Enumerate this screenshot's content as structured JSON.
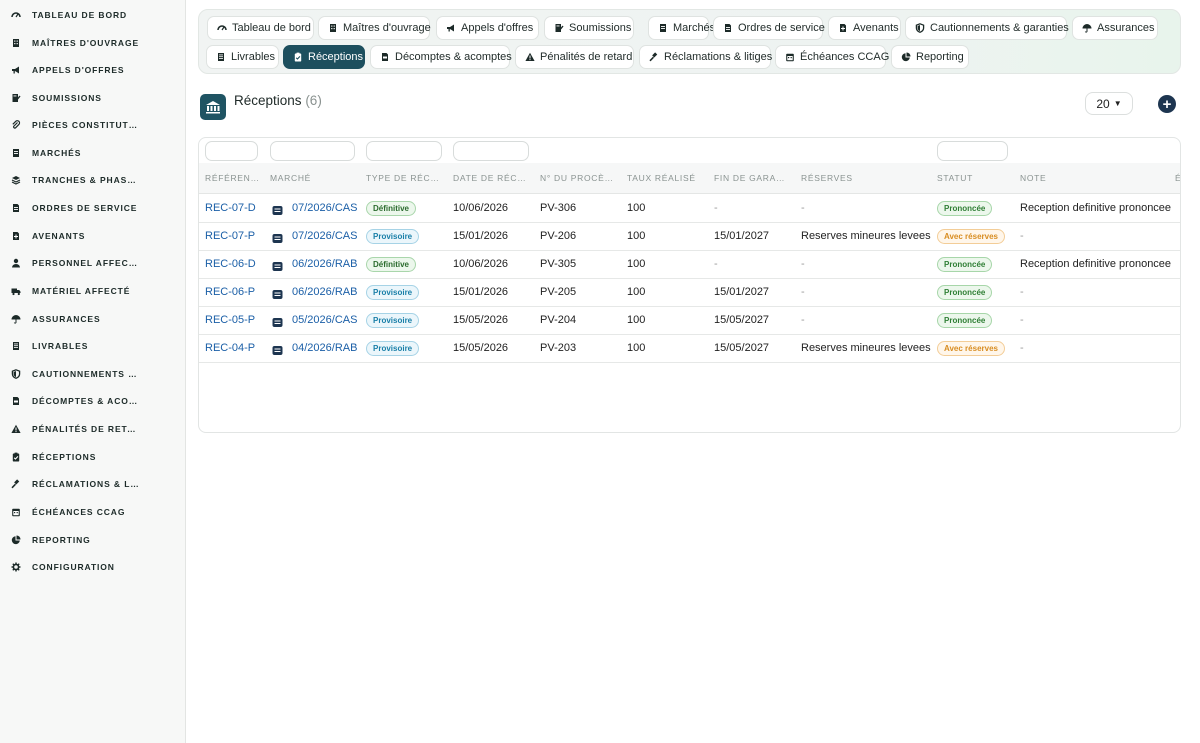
{
  "sidebar": {
    "items": [
      {
        "label": "TABLEAU DE BORD",
        "icon": "dashboard-icon"
      },
      {
        "label": "MAÎTRES D'OUVRAGE",
        "icon": "building-icon"
      },
      {
        "label": "APPELS D'OFFRES",
        "icon": "megaphone-icon"
      },
      {
        "label": "SOUMISSIONS",
        "icon": "file-signature-icon"
      },
      {
        "label": "PIÈCES CONSTITUTIVES",
        "icon": "paperclip-icon"
      },
      {
        "label": "MARCHÉS",
        "icon": "file-contract-icon"
      },
      {
        "label": "TRANCHES & PHASES",
        "icon": "layers-icon"
      },
      {
        "label": "ORDRES DE SERVICE",
        "icon": "file-icon"
      },
      {
        "label": "AVENANTS",
        "icon": "file-plus-icon"
      },
      {
        "label": "PERSONNEL AFFECTÉ",
        "icon": "user-icon"
      },
      {
        "label": "MATÉRIEL AFFECTÉ",
        "icon": "truck-icon"
      },
      {
        "label": "ASSURANCES",
        "icon": "umbrella-icon"
      },
      {
        "label": "LIVRABLES",
        "icon": "file-alt-icon"
      },
      {
        "label": "CAUTIONNEMENTS & GARANTIES",
        "icon": "shield-icon"
      },
      {
        "label": "DÉCOMPTES & ACOMPTES",
        "icon": "file-invoice-icon"
      },
      {
        "label": "PÉNALITÉS DE RETARD",
        "icon": "warning-icon"
      },
      {
        "label": "RÉCEPTIONS",
        "icon": "clipboard-check-icon"
      },
      {
        "label": "RÉCLAMATIONS & LITIGES",
        "icon": "gavel-icon"
      },
      {
        "label": "ÉCHÉANCES CCAG",
        "icon": "calendar-icon"
      },
      {
        "label": "REPORTING",
        "icon": "pie-chart-icon"
      },
      {
        "label": "CONFIGURATION",
        "icon": "gear-icon"
      }
    ]
  },
  "tabs": [
    {
      "label": "Tableau de bord",
      "icon": "dashboard-icon"
    },
    {
      "label": "Maîtres d'ouvrage",
      "icon": "building-icon"
    },
    {
      "label": "Appels d'offres",
      "icon": "megaphone-icon"
    },
    {
      "label": "Soumissions",
      "icon": "file-signature-icon"
    },
    {
      "label": "Marchés",
      "icon": "file-contract-icon"
    },
    {
      "label": "Ordres de service",
      "icon": "file-icon"
    },
    {
      "label": "Avenants",
      "icon": "file-plus-icon"
    },
    {
      "label": "Cautionnements & garanties",
      "icon": "shield-icon"
    },
    {
      "label": "Assurances",
      "icon": "umbrella-icon"
    },
    {
      "label": "Livrables",
      "icon": "file-alt-icon"
    },
    {
      "label": "Réceptions",
      "icon": "clipboard-check-icon",
      "active": true
    },
    {
      "label": "Décomptes & acomptes",
      "icon": "file-invoice-icon"
    },
    {
      "label": "Pénalités de retard",
      "icon": "warning-icon"
    },
    {
      "label": "Réclamations & litiges",
      "icon": "gavel-icon"
    },
    {
      "label": "Échéances CCAG",
      "icon": "calendar-icon"
    },
    {
      "label": "Reporting",
      "icon": "pie-chart-icon"
    }
  ],
  "header": {
    "title": "Réceptions",
    "count": "(6)",
    "page_size": "20",
    "add_label": "+"
  },
  "table": {
    "columns": [
      "RÉFÉRENCE",
      "MARCHÉ",
      "TYPE DE RÉCEPTION",
      "DATE DE RÉCEPTION",
      "N° DU PROCÈS-VERBAL",
      "TAUX RÉALISÉ",
      "FIN DE GARANTIE",
      "RÉSERVES",
      "STATUT",
      "NOTE",
      "É"
    ],
    "rows": [
      {
        "ref": "REC-07-D",
        "marche": "07/2026/CAS",
        "type": "Définitive",
        "date": "10/06/2026",
        "pv": "PV-306",
        "taux": "100",
        "fin": "-",
        "reserves": "-",
        "statut": "Prononcée",
        "note": "Reception definitive prononcee"
      },
      {
        "ref": "REC-07-P",
        "marche": "07/2026/CAS",
        "type": "Provisoire",
        "date": "15/01/2026",
        "pv": "PV-206",
        "taux": "100",
        "fin": "15/01/2027",
        "reserves": "Reserves mineures levees",
        "statut": "Avec réserves",
        "note": "-"
      },
      {
        "ref": "REC-06-D",
        "marche": "06/2026/RAB",
        "type": "Définitive",
        "date": "10/06/2026",
        "pv": "PV-305",
        "taux": "100",
        "fin": "-",
        "reserves": "-",
        "statut": "Prononcée",
        "note": "Reception definitive prononcee"
      },
      {
        "ref": "REC-06-P",
        "marche": "06/2026/RAB",
        "type": "Provisoire",
        "date": "15/01/2026",
        "pv": "PV-205",
        "taux": "100",
        "fin": "15/01/2027",
        "reserves": "-",
        "statut": "Prononcée",
        "note": "-"
      },
      {
        "ref": "REC-05-P",
        "marche": "05/2026/CAS",
        "type": "Provisoire",
        "date": "15/05/2026",
        "pv": "PV-204",
        "taux": "100",
        "fin": "15/05/2027",
        "reserves": "-",
        "statut": "Prononcée",
        "note": "-"
      },
      {
        "ref": "REC-04-P",
        "marche": "04/2026/RAB",
        "type": "Provisoire",
        "date": "15/05/2026",
        "pv": "PV-203",
        "taux": "100",
        "fin": "15/05/2027",
        "reserves": "Reserves mineures levees",
        "statut": "Avec réserves",
        "note": "-"
      }
    ]
  },
  "colors": {
    "accent": "#1d4f5e",
    "link": "#1b5fa7",
    "definitive": "#2b6b2e",
    "provisoire": "#197fa8",
    "prononcee": "#2f7f35",
    "avec_reserves": "#d88d22"
  }
}
